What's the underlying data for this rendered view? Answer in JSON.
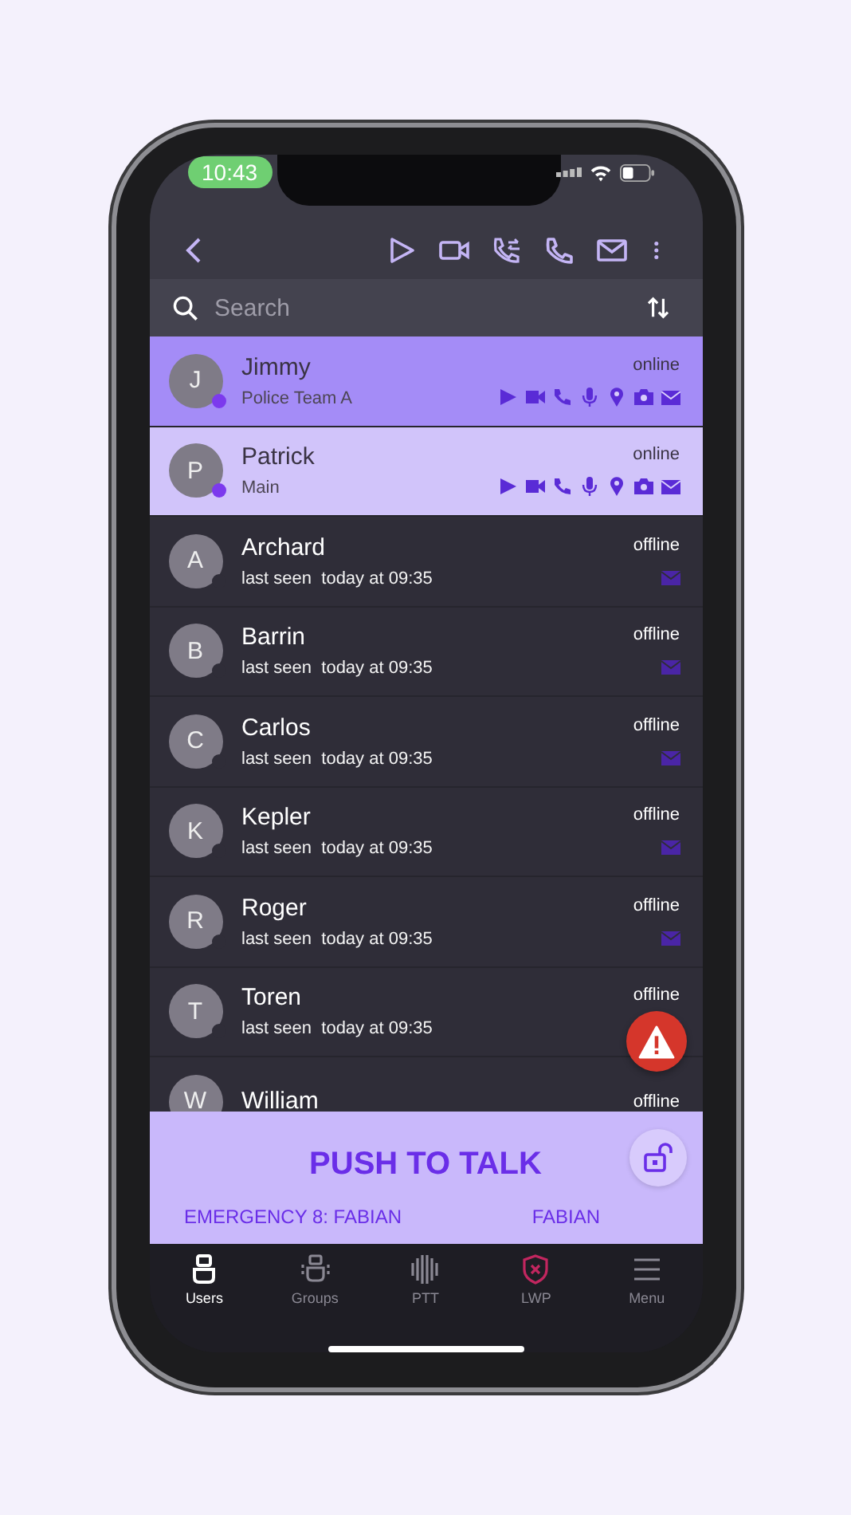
{
  "status_bar": {
    "time": "10:43"
  },
  "search": {
    "placeholder": "Search"
  },
  "contacts": [
    {
      "initial": "J",
      "name": "Jimmy",
      "subtitle": "Police Team A",
      "status": "online",
      "online": true,
      "selected": true
    },
    {
      "initial": "P",
      "name": "Patrick",
      "subtitle": "Main",
      "status": "online",
      "online": true,
      "selected": false
    },
    {
      "initial": "A",
      "name": "Archard",
      "subtitle": "last seen  today at 09:35",
      "status": "offline",
      "online": false,
      "selected": false
    },
    {
      "initial": "B",
      "name": "Barrin",
      "subtitle": "last seen  today at 09:35",
      "status": "offline",
      "online": false,
      "selected": false
    },
    {
      "initial": "C",
      "name": "Carlos",
      "subtitle": "last seen  today at 09:35",
      "status": "offline",
      "online": false,
      "selected": false
    },
    {
      "initial": "K",
      "name": "Kepler",
      "subtitle": "last seen  today at 09:35",
      "status": "offline",
      "online": false,
      "selected": false
    },
    {
      "initial": "R",
      "name": "Roger",
      "subtitle": "last seen  today at 09:35",
      "status": "offline",
      "online": false,
      "selected": false
    },
    {
      "initial": "T",
      "name": "Toren",
      "subtitle": "last seen  today at 09:35",
      "status": "offline",
      "online": false,
      "selected": false
    },
    {
      "initial": "W",
      "name": "William",
      "status": "offline",
      "online": false,
      "selected": false
    }
  ],
  "ptt": {
    "title": "PUSH TO TALK",
    "left": "EMERGENCY 8: FABIAN",
    "right": "FABIAN"
  },
  "tabs": [
    {
      "label": "Users",
      "kind": "users",
      "selected": true,
      "alert": false
    },
    {
      "label": "Groups",
      "kind": "groups",
      "selected": false,
      "alert": false
    },
    {
      "label": "PTT",
      "kind": "ptt",
      "selected": false,
      "alert": false
    },
    {
      "label": "LWP",
      "kind": "lwp",
      "selected": false,
      "alert": true
    },
    {
      "label": "Menu",
      "kind": "menu",
      "selected": false,
      "alert": false
    }
  ]
}
